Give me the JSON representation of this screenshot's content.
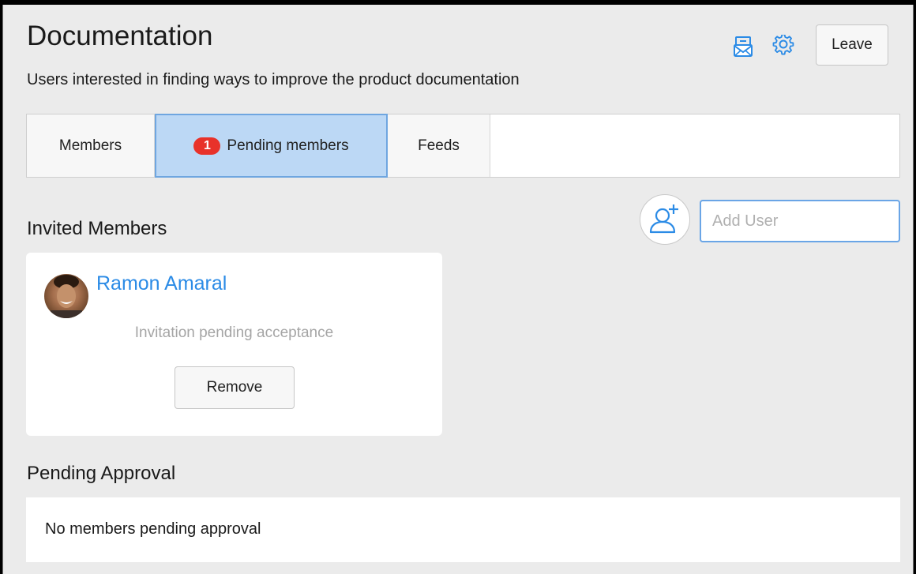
{
  "group": {
    "title": "Documentation",
    "description": "Users interested in finding ways to improve the product documentation"
  },
  "header": {
    "leave_label": "Leave",
    "icons": [
      "email-unsubscribe-icon",
      "gear-icon"
    ]
  },
  "tabs": [
    {
      "label": "Members",
      "active": false
    },
    {
      "label": "Pending members",
      "badge": "1",
      "active": true
    },
    {
      "label": "Feeds",
      "active": false
    }
  ],
  "invited": {
    "title": "Invited Members",
    "add_user_placeholder": "Add User",
    "members": [
      {
        "name": "Ramon Amaral",
        "status": "Invitation pending acceptance",
        "action": "Remove"
      }
    ]
  },
  "pending_approval": {
    "title": "Pending Approval",
    "empty_text": "No members pending approval"
  },
  "colors": {
    "accent": "#2b8be6",
    "badge": "#e8322a",
    "active_tab": "#bcd8f5",
    "background": "#ebebeb"
  }
}
